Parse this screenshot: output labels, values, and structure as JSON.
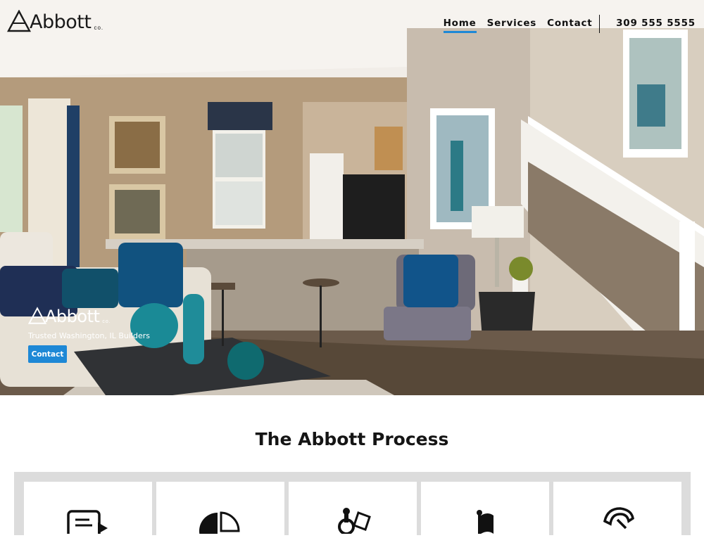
{
  "header": {
    "brand": {
      "word": "Abbott",
      "suffix": "co."
    },
    "nav": [
      {
        "label": "Home",
        "active": true
      },
      {
        "label": "Services",
        "active": false
      },
      {
        "label": "Contact",
        "active": false
      }
    ],
    "phone": "309 555 5555",
    "accent_color": "#1e88d6"
  },
  "hero": {
    "logo": {
      "word": "Abbott",
      "suffix": "co."
    },
    "tagline": "Trusted Washington, IL Builders",
    "cta_label": "Contact"
  },
  "process": {
    "title": "The Abbott Process",
    "steps": [
      {
        "icon": "document-icon"
      },
      {
        "icon": "pie-chart-icon"
      },
      {
        "icon": "tools-icon"
      },
      {
        "icon": "flag-icon"
      },
      {
        "icon": "key-icon"
      }
    ]
  }
}
